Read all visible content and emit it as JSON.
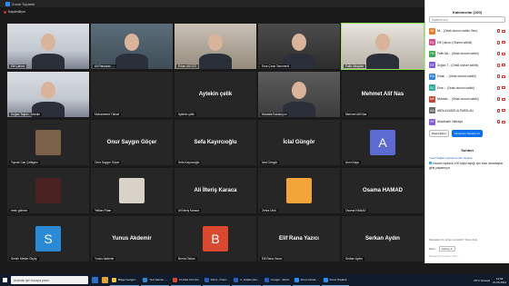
{
  "window": {
    "title": "Zoom Toplantı",
    "recording_label": "Kaydediliyor"
  },
  "grid": [
    {
      "name": "Elif Çakırcı",
      "kind": "video",
      "scene": "p1"
    },
    {
      "name": "Ali Ramazan ...",
      "kind": "video",
      "scene": "p2"
    },
    {
      "name": "Erkan AKGÖZ",
      "kind": "video",
      "scene": "p3"
    },
    {
      "name": "Esra Çınar Tanrıverdi",
      "kind": "video",
      "scene": "p4"
    },
    {
      "name": "Fatih Alkaptan",
      "kind": "video",
      "scene": "p5",
      "active": true
    },
    {
      "name": "Doğan Taşkın - Mardin",
      "kind": "video",
      "scene": "p1"
    },
    {
      "name": "Muhammed Yüksel",
      "kind": "dark"
    },
    {
      "name": "Aytekin çelik",
      "kind": "text",
      "big": "Aytekin çelik"
    },
    {
      "name": "Mustafa Karakoyun",
      "kind": "video",
      "scene": "p6"
    },
    {
      "name": "Mehmet Alif Nas",
      "kind": "text",
      "big": "Mehmet Alif Nas"
    },
    {
      "name": "Toprak Can Çelikgen",
      "kind": "photo",
      "tone": "#7a6148"
    },
    {
      "name": "Onur Saygın Göçer",
      "kind": "text",
      "big": "Onur Saygın Göçer"
    },
    {
      "name": "Sefa Kayırcıoğlu",
      "kind": "text",
      "big": "Sefa Kayırcıoğlu"
    },
    {
      "name": "İclal Güngör",
      "kind": "text",
      "big": "İclal Güngör"
    },
    {
      "name": "Arzu Kaya",
      "kind": "avatar",
      "letter": "A",
      "color": "#5b6bd1"
    },
    {
      "name": "emin gülmez",
      "kind": "photo",
      "tone": "#4a2222"
    },
    {
      "name": "Yelkan Fidan",
      "kind": "photo",
      "tone": "#d8d2c8"
    },
    {
      "name": "Ali İlteriş Karaca",
      "kind": "text",
      "big": "Ali İlteriş Karaca"
    },
    {
      "name": "Zehra Ünlü",
      "kind": "photo",
      "tone": "#f2a63a"
    },
    {
      "name": "Osama HAMAD",
      "kind": "text",
      "big": "Osama HAMAD"
    },
    {
      "name": "Semih Mesim Ölçüp",
      "kind": "avatar",
      "letter": "S",
      "color": "#2b8ad6"
    },
    {
      "name": "Yunus Akdemir",
      "kind": "text",
      "big": "Yunus Akdemir"
    },
    {
      "name": "Berna Özkan",
      "kind": "avatar",
      "letter": "B",
      "color": "#d9482f"
    },
    {
      "name": "Elif Rana Yazıcı",
      "kind": "text",
      "big": "Elif Rana Yazıcı"
    },
    {
      "name": "Serkan Aydın",
      "kind": "text",
      "big": "Serkan Aydın"
    }
  ],
  "participants_panel": {
    "header": "Katılımcılar (100)",
    "search_placeholder": "Katılımcı bul",
    "items": [
      {
        "initials": "Mi",
        "color": "#e0802a",
        "name": "Mi... (Ortak oturum sahibi, Ben)"
      },
      {
        "initials": "EÇ",
        "color": "#d64a8a",
        "name": "Elif Çakırcı (Oturum sahibi)"
      },
      {
        "initials": "FA",
        "color": "#3aa657",
        "name": "Fatih Alk... (Ortak oturum sahibi)"
      },
      {
        "initials": "DT",
        "color": "#7b5bd6",
        "name": "Doğan T... (Ortak oturum sahibi)"
      },
      {
        "initials": "EA",
        "color": "#2f87d6",
        "name": "Erkan ... (Ortak oturum sahibi)"
      },
      {
        "initials": "EÇ",
        "color": "#2aa9a0",
        "name": "Esra ... (Ortak oturum sahibi)"
      },
      {
        "initials": "MK",
        "color": "#c2452f",
        "name": "Mustafa ... (Ortak oturum sahibi)"
      },
      {
        "initials": "AA",
        "color": "#6b6b6b",
        "name": "ABDULKADİR ALPARSLAN"
      },
      {
        "initials": "AY",
        "color": "#8a5bd6",
        "name": "Abdulkadir Yaltkaya"
      }
    ],
    "invite_button": "Davet Eden",
    "mute_all_button": "Tamamını Sessize Al"
  },
  "chat": {
    "header": "Sohbet",
    "from": "Yusuf Sağlam gönderenden Herkes:",
    "message": "Hocam toplantı 100 kişiyi aştığı için bazı arkadaşlar giriş yapamıyor",
    "note": "Mesajlarınızı kimler görebilir? Kayıt Açık",
    "to_label": "Kime:",
    "to_value": "Herkes ▾",
    "input_placeholder": "Mesajınızı buraya yazın..."
  },
  "taskbar": {
    "search_placeholder": "Aramak için buraya yazın",
    "tasks": [
      {
        "label": "Belge Gezgini...",
        "color": "#f2c33a"
      },
      {
        "label": "Yeni Sekme -...",
        "color": "#2b8ad6"
      },
      {
        "label": "FLASH CCI.tmv",
        "color": "#d64a2a"
      },
      {
        "label": "Word - Öneri...",
        "color": "#2b5fb8"
      },
      {
        "label": "2. Güçlen.(Ke...",
        "color": "#2b5fb8"
      },
      {
        "label": "Kongre - Word",
        "color": "#2b5fb8"
      },
      {
        "label": "Zoom Cloud...",
        "color": "#2d8cff"
      },
      {
        "label": "Zoom Toplantı",
        "color": "#2d8cff"
      }
    ],
    "weather": "28°C Güneşli",
    "time": "13:58",
    "date": "21.05.2022"
  }
}
